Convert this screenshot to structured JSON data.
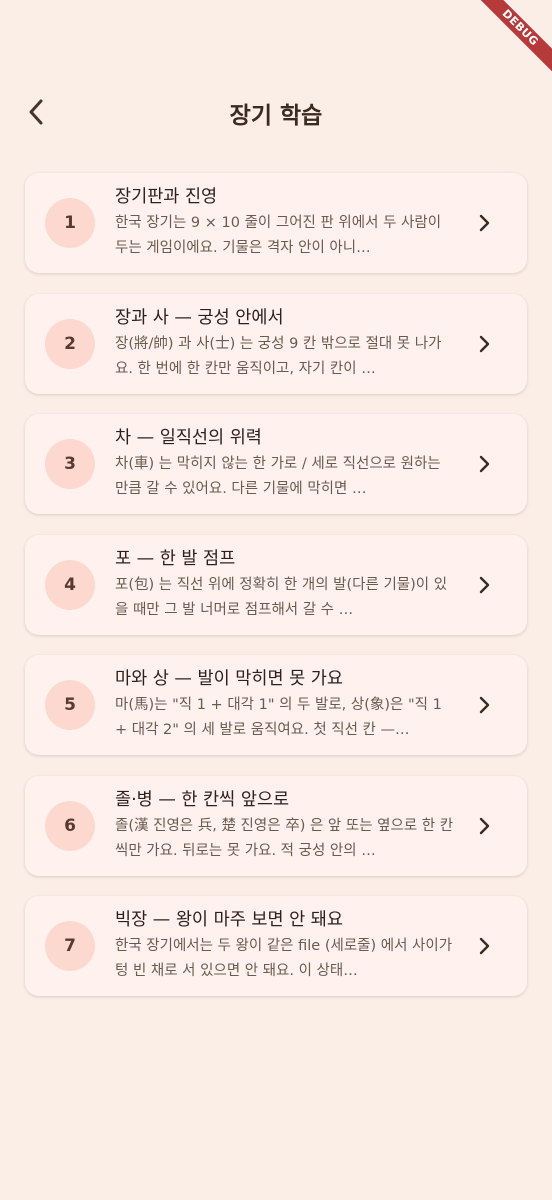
{
  "debug_label": "DEBUG",
  "header": {
    "title": "장기 학습",
    "back_icon": "arrow-back-icon"
  },
  "lessons": [
    {
      "number": "1",
      "title": "장기판과 진영",
      "description": "한국 장기는 9 × 10 줄이 그어진 판 위에서 두 사람이 두는 게임이에요. 기물은 격자 안이 아니…"
    },
    {
      "number": "2",
      "title": "장과 사 — 궁성 안에서",
      "description": "장(將/帥) 과 사(士) 는 궁성 9 칸 밖으로 절대 못 나가요. 한 번에 한 칸만 움직이고, 자기 칸이 …"
    },
    {
      "number": "3",
      "title": "차 — 일직선의 위력",
      "description": "차(車) 는 막히지 않는 한 가로 / 세로 직선으로 원하는 만큼 갈 수 있어요. 다른 기물에 막히면 …"
    },
    {
      "number": "4",
      "title": "포 — 한 발 점프",
      "description": "포(包) 는 직선 위에 정확히 한 개의 발(다른 기물)이 있을 때만 그 발 너머로 점프해서 갈 수 …"
    },
    {
      "number": "5",
      "title": "마와 상 — 발이 막히면 못 가요",
      "description": "마(馬)는 \"직 1 + 대각 1\" 의 두 발로, 상(象)은 \"직 1 + 대각 2\" 의 세 발로 움직여요. 첫 직선 칸 —…"
    },
    {
      "number": "6",
      "title": "졸·병 — 한 칸씩 앞으로",
      "description": "졸(漢 진영은 兵, 楚 진영은 卒) 은 앞 또는 옆으로 한 칸씩만 가요. 뒤로는 못 가요. 적 궁성 안의 …"
    },
    {
      "number": "7",
      "title": "빅장 — 왕이 마주 보면 안 돼요",
      "description": "한국 장기에서는 두 왕이 같은 file (세로줄) 에서 사이가 텅 빈 채로 서 있으면 안 돼요. 이 상태…"
    }
  ],
  "chevron_icon": "chevron-right-icon",
  "colors": {
    "background": "#fbeee7",
    "card": "#fff2ee",
    "number_circle": "#fdd8cf",
    "title_text": "#2c211b",
    "desc_text": "#6b5a50",
    "debug_ribbon": "#b73a3a"
  }
}
